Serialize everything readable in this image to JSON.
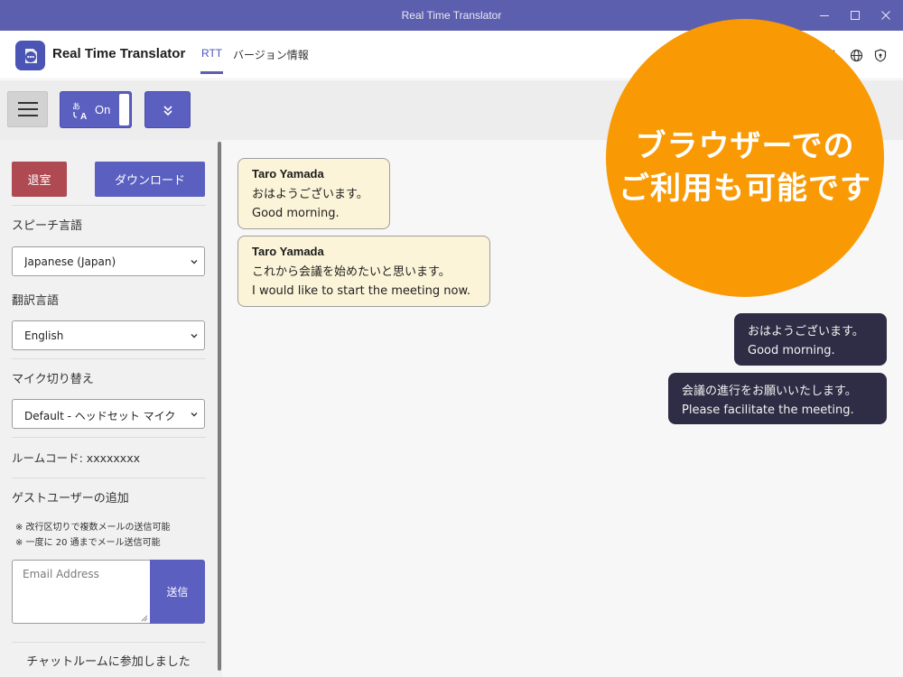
{
  "window": {
    "title": "Real Time Translator"
  },
  "header": {
    "app_name": "Real Time Translator",
    "tabs": [
      {
        "label": "RTT",
        "active": true
      },
      {
        "label": "バージョン情報",
        "active": false
      }
    ],
    "icons": [
      "refresh-icon",
      "globe-icon",
      "shield-icon"
    ]
  },
  "toolbar": {
    "translate_toggle_label": "On",
    "translate_toggle_state": true
  },
  "sidebar": {
    "leave_label": "退室",
    "download_label": "ダウンロード",
    "speech_language_label": "スピーチ言語",
    "speech_language_value": "Japanese (Japan)",
    "translation_language_label": "翻訳言語",
    "translation_language_value": "English",
    "mic_label": "マイク切り替え",
    "mic_value": "Default - ヘッドセット マイク",
    "room_code_label": "ルームコード: xxxxxxxx",
    "guest_label": "ゲストユーザーの追加",
    "note1": "※ 改行区切りで複数メールの送信可能",
    "note2": "※ 一度に 20 通までメール送信可能",
    "email_placeholder": "Email Address",
    "send_label": "送信",
    "joined_text": "チャットルームに参加しました"
  },
  "chat": {
    "messages": [
      {
        "sender": "Taro Yamada",
        "original": "おはようございます。",
        "translated": "Good morning."
      },
      {
        "sender": "Taro Yamada",
        "original": "これから会議を始めたいと思います。",
        "translated": "I would like to start the meeting now."
      },
      {
        "original": "おはようございます。",
        "translated": "Good morning."
      },
      {
        "original": "会議の進行をお願いいたします。",
        "translated": "Please facilitate the meeting."
      }
    ]
  },
  "promo": {
    "line1": "ブラウザーでの",
    "line2": "ご利用も可能です"
  },
  "colors": {
    "titlebar": "#5b5fae",
    "accent": "#5b5fc0",
    "leave": "#b04a52",
    "incoming_bubble": "#fbf4d8",
    "outgoing_bubble": "#2f2d45",
    "promo": "#f99a05"
  }
}
